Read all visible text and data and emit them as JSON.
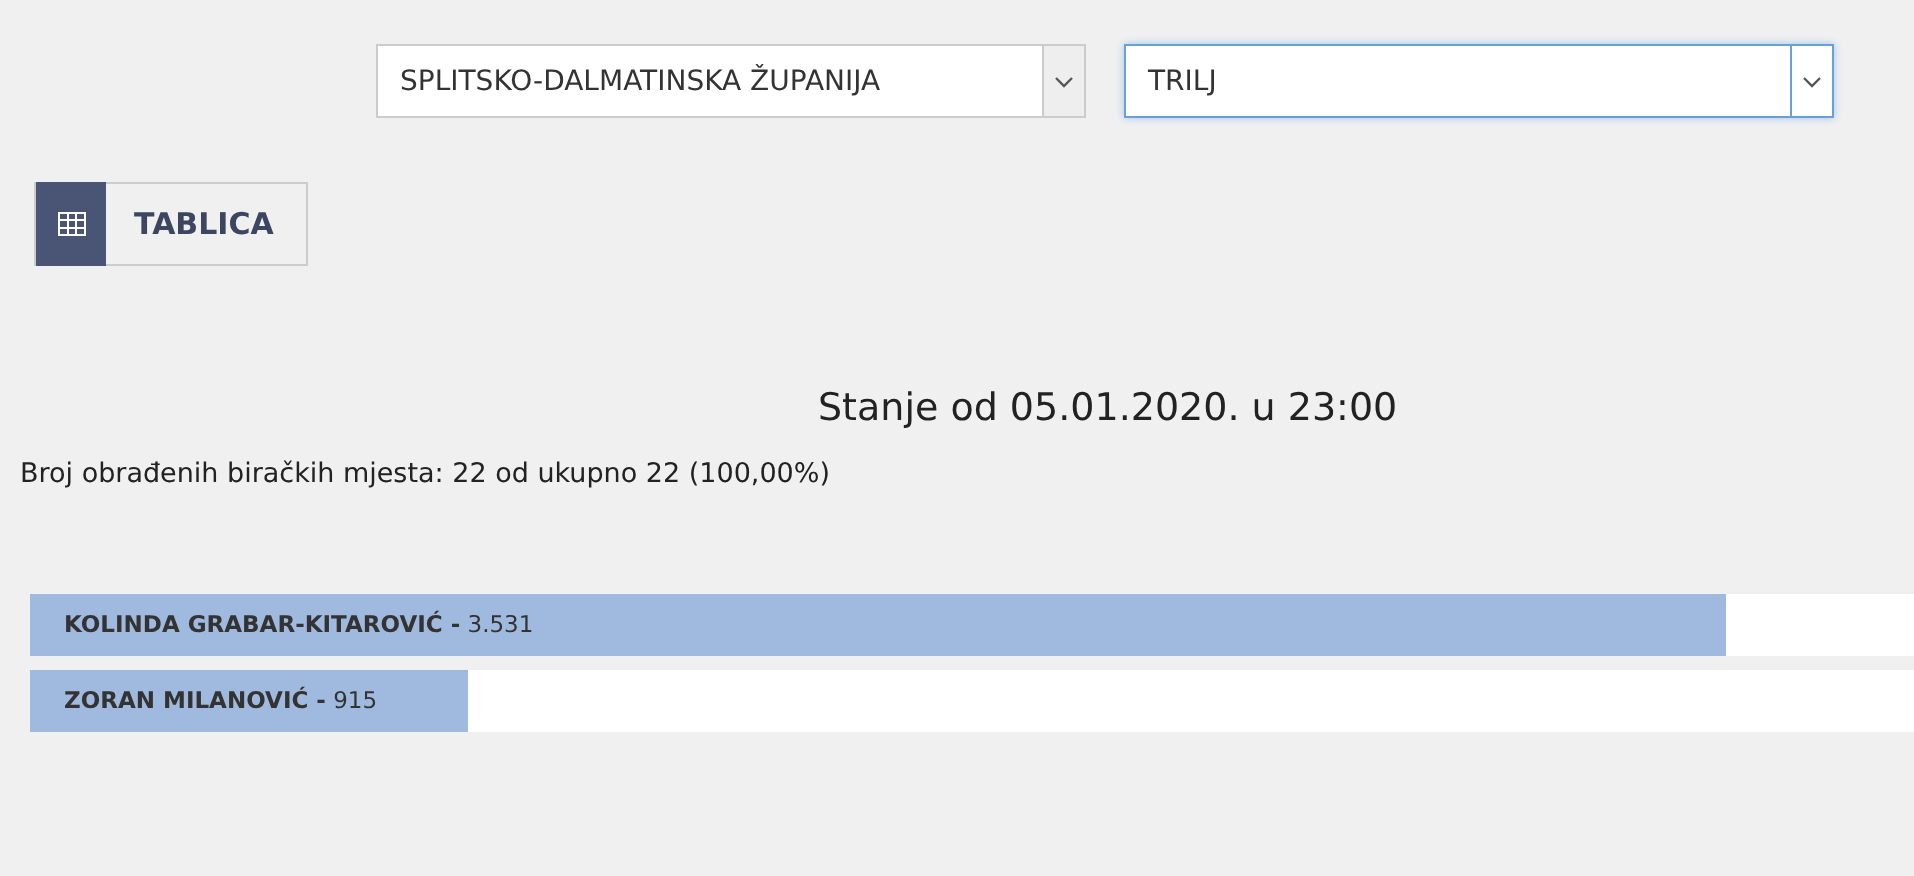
{
  "filters": [
    {
      "value": "SPLITSKO-DALMATINSKA ŽUPANIJA",
      "focused": false
    },
    {
      "value": "TRILJ",
      "focused": true
    }
  ],
  "view_button": {
    "label": "TABLICA"
  },
  "title": "Stanje od 05.01.2020. u 23:00",
  "summary": "Broj obrađenih biračkih mjesta: 22 od ukupno 22 (100,00%)",
  "results": [
    {
      "label": "**KOLINDA GRABAR-KITAROVIĆ -** 3.531",
      "level": 0.9
    },
    {
      "label": "**ZORAN MILANOVIĆ -** 915",
      "level": 0.232
    }
  ]
}
